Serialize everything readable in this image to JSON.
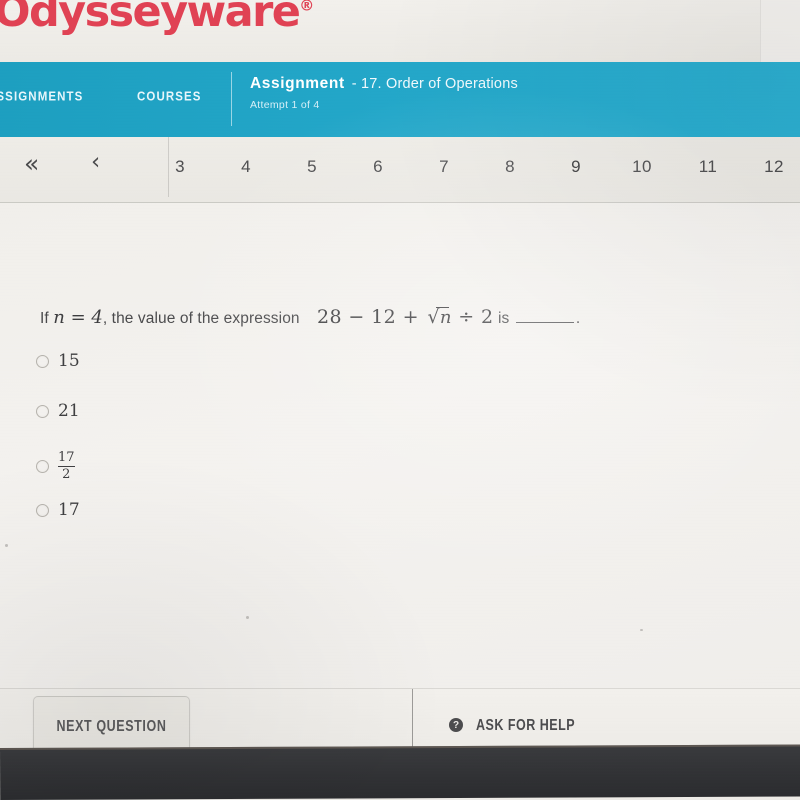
{
  "brand": {
    "logo_text": "Odysseyware",
    "registered_mark": "®",
    "logo_color": "#e04254",
    "nav_color": "#23a7c9",
    "accent_color": "#2aa9cb"
  },
  "navbar": {
    "assignments_label": "ASSIGNMENTS",
    "courses_label": "COURSES",
    "assignment_label": "Assignment",
    "assignment_name": "- 17. Order of Operations",
    "attempt_text": "Attempt 1 of 4"
  },
  "pagination": {
    "first_icon": "«",
    "prev_icon": "‹",
    "pages": [
      "3",
      "4",
      "5",
      "6",
      "7",
      "8",
      "9",
      "10",
      "11",
      "12"
    ],
    "active_page": "9"
  },
  "question": {
    "prefix": "If",
    "var_assign": "n = 4",
    "middle": ", the value of the expression",
    "expression_lead": "28 − 12 + ",
    "sqrt_symbol": "√",
    "sqrt_operand": "n",
    "expression_tail": " ÷ 2",
    "suffix": "is",
    "period": ".",
    "options": [
      {
        "label": "15",
        "type": "plain",
        "selected": false
      },
      {
        "label": "21",
        "type": "plain",
        "selected": false
      },
      {
        "numerator": "17",
        "denominator": "2",
        "type": "fraction",
        "selected": false
      },
      {
        "label": "17",
        "type": "plain",
        "selected": false
      }
    ]
  },
  "footer": {
    "next_question_label": "NEXT QUESTION",
    "help_icon_glyph": "?",
    "ask_for_help_label": "ASK FOR HELP"
  }
}
